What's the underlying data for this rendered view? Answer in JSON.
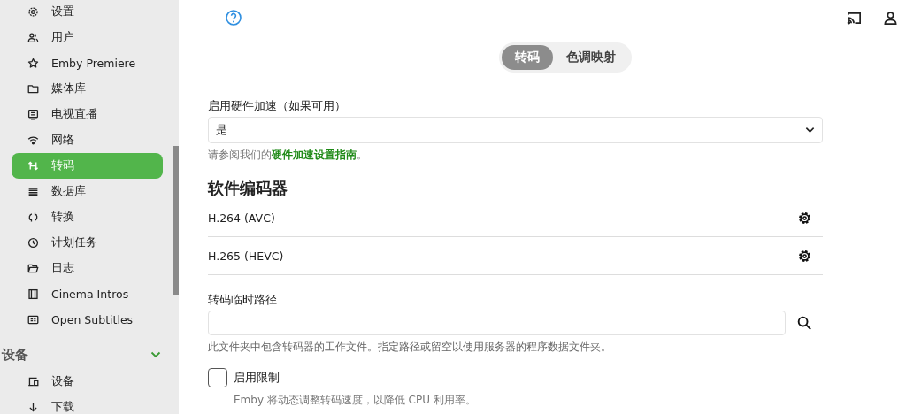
{
  "sidebar": {
    "items": [
      {
        "label": "设置",
        "selected": false
      },
      {
        "label": "用户",
        "selected": false
      },
      {
        "label": "Emby Premiere",
        "selected": false
      },
      {
        "label": "媒体库",
        "selected": false
      },
      {
        "label": "电视直播",
        "selected": false
      },
      {
        "label": "网络",
        "selected": false
      },
      {
        "label": "转码",
        "selected": true
      },
      {
        "label": "数据库",
        "selected": false
      },
      {
        "label": "转换",
        "selected": false
      },
      {
        "label": "计划任务",
        "selected": false
      },
      {
        "label": "日志",
        "selected": false
      },
      {
        "label": "Cinema Intros",
        "selected": false
      },
      {
        "label": "Open Subtitles",
        "selected": false
      }
    ],
    "section": {
      "title": "设备",
      "expanded": true,
      "items": [
        {
          "label": "设备",
          "selected": false
        },
        {
          "label": "下载",
          "selected": false
        }
      ]
    }
  },
  "tabs": [
    {
      "label": "转码",
      "selected": true
    },
    {
      "label": "色调映射",
      "selected": false
    }
  ],
  "hardware_acceleration": {
    "label": "启用硬件加速（如果可用）",
    "value": "是",
    "help": "请参阅我们的",
    "help_link": "硬件加速设置指南",
    "help_end": "。"
  },
  "software_encoders": {
    "title": "软件编码器",
    "items": [
      {
        "name": "H.264 (AVC)"
      },
      {
        "name": "H.265 (HEVC)"
      }
    ]
  },
  "temp_path": {
    "label": "转码临时路径",
    "help": "此文件夹中包含转码器的工作文件。指定路径或留空以使用服务器的程序数据文件夹。"
  },
  "throttle": {
    "label": "启用限制",
    "checked": false,
    "help": "Emby 将动态调整转码速度，以降低 CPU 利用率。"
  }
}
